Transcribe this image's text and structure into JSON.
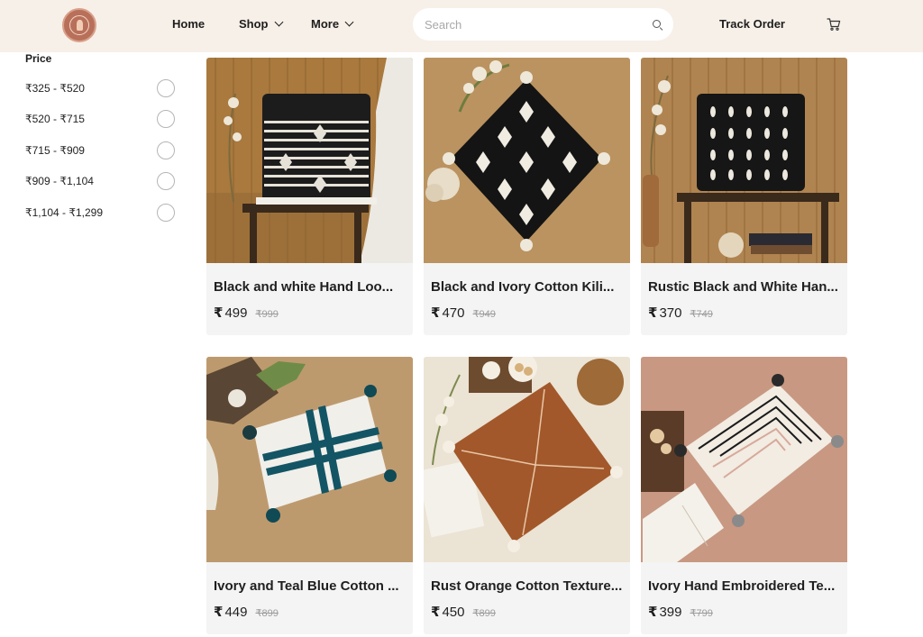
{
  "nav": {
    "home": "Home",
    "shop": "Shop",
    "more": "More",
    "track_order": "Track Order"
  },
  "search": {
    "placeholder": "Search"
  },
  "icons": {
    "logo": "brand-logo",
    "search": "search-icon",
    "cart": "cart-icon",
    "dropdown": "chevron-down-icon",
    "radio": "radio-unchecked"
  },
  "filter": {
    "title": "Price",
    "options": [
      "₹325 - ₹520",
      "₹520 - ₹715",
      "₹715 - ₹909",
      "₹909 - ₹1,104",
      "₹1,104 - ₹1,299"
    ]
  },
  "currency_symbol": "₹",
  "products": [
    {
      "title": "Black and white Hand Loo...",
      "price": "499",
      "mrp": "₹999"
    },
    {
      "title": "Black and Ivory Cotton Kili...",
      "price": "470",
      "mrp": "₹949"
    },
    {
      "title": "Rustic Black and White Han...",
      "price": "370",
      "mrp": "₹749"
    },
    {
      "title": "Ivory and Teal Blue Cotton ...",
      "price": "449",
      "mrp": "₹899"
    },
    {
      "title": "Rust Orange Cotton Texture...",
      "price": "450",
      "mrp": "₹899"
    },
    {
      "title": "Ivory Hand Embroidered Te...",
      "price": "399",
      "mrp": "₹799"
    }
  ],
  "colors": {
    "header_bg": "#f7f0e8",
    "card_bg": "#f4f4f4",
    "logo": "#b8705a",
    "text": "#1d1d1d",
    "mrp_text": "#9c9c9c"
  }
}
